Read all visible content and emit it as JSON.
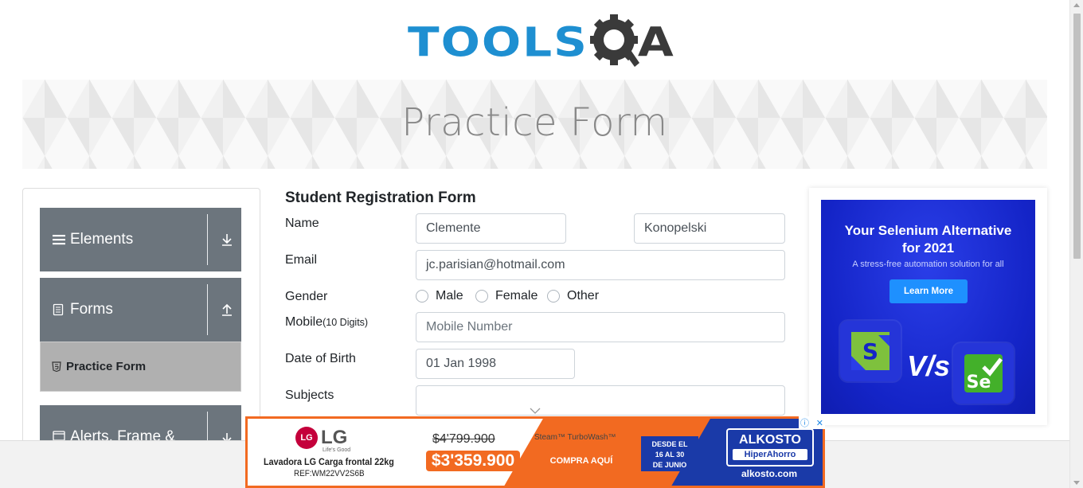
{
  "header": {
    "logo_text": "TOOLS",
    "logo_q": "Q",
    "logo_a": "A"
  },
  "banner": {
    "title": "Practice Form"
  },
  "sidebar": {
    "groups": [
      {
        "label": "Elements",
        "icon": "hamburger-icon",
        "arrow": "download-arrow-icon"
      },
      {
        "label": "Forms",
        "icon": "document-icon",
        "arrow": "upload-arrow-icon"
      },
      {
        "label": "Alerts, Frame &",
        "icon": "window-icon",
        "arrow": "download-arrow-icon"
      }
    ],
    "active_item": {
      "label": "Practice Form",
      "icon": "html5-icon"
    }
  },
  "form": {
    "title": "Student Registration Form",
    "name_label": "Name",
    "first_name": "Clemente",
    "last_name": "Konopelski",
    "email_label": "Email",
    "email": "jc.parisian@hotmail.com",
    "gender_label": "Gender",
    "gender_options": [
      "Male",
      "Female",
      "Other"
    ],
    "mobile_label": "Mobile",
    "mobile_hint": "(10 Digits)",
    "mobile_placeholder": "Mobile Number",
    "dob_label": "Date of Birth",
    "dob": "01 Jan 1998",
    "subjects_label": "Subjects",
    "subjects_value": ""
  },
  "right_ad": {
    "headline_1": "Your Selenium Alternative",
    "headline_2": "for 2021",
    "sub": "A stress-free automation solution for all",
    "button": "Learn More",
    "left_logo": "S",
    "vs": "V/s",
    "right_logo": "Se",
    "bg_color": "#1424c7"
  },
  "bottom_ad": {
    "brand": "LG",
    "brand_badge": "LG",
    "tagline": "Life's Good",
    "product": "Lavadora LG Carga frontal 22kg",
    "ref": "REF:WM22VV2S6B",
    "old_price": "$4'799.900",
    "new_price": "$3'359.900",
    "features": "Steam™ TurboWash™",
    "cta": "COMPRA AQUÍ",
    "dates_1": "DESDE EL",
    "dates_2": "16 AL 30",
    "dates_3": "DE JUNIO",
    "store": "ALKOSTO",
    "store_sub": "HiperAhorro",
    "store_url": "alkosto.com",
    "info_glyph": "ⓘ",
    "close_glyph": "✕",
    "accent_color": "#f26a21"
  }
}
